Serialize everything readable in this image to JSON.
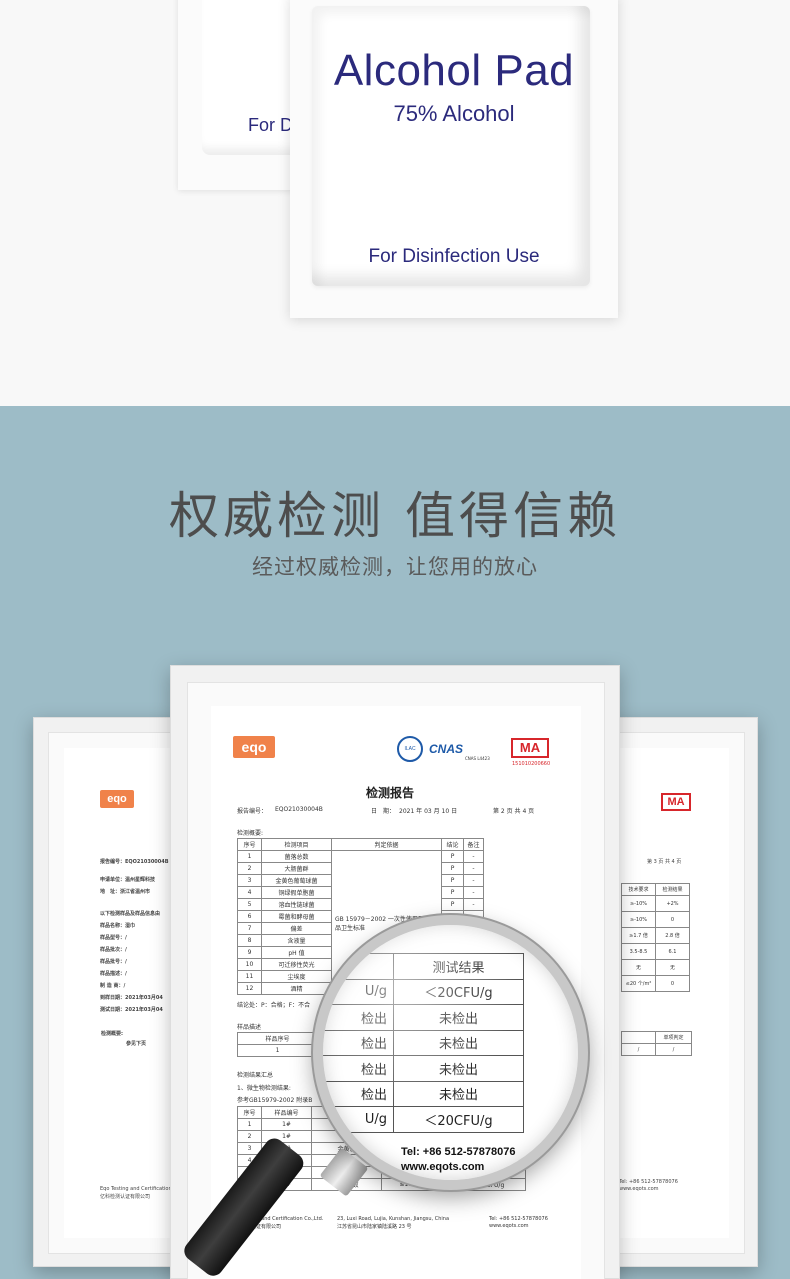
{
  "product": {
    "back_pad_text": "For Di",
    "title": "Alcohol Pad",
    "subtitle": "75% Alcohol",
    "usage": "For Disinfection Use",
    "brand_color": "#2b2a7c"
  },
  "section": {
    "headline": "权威检测 值得信赖",
    "subheadline": "经过权威检测，让您用的放心",
    "background_color": "#9dbcc7"
  },
  "report": {
    "logo": "eqo",
    "cma": "MA",
    "cma_number": "151010200660",
    "cnas": "CNAS",
    "cnas_code": "CNAS L4423",
    "title": "检测报告",
    "report_no_label": "报告编号：",
    "report_no": "EQO2103000​4B",
    "date_label": "日　期：",
    "date": "2021 年 03 月 10 日",
    "page": "第 2 页 共 4 页",
    "summary_label": "检测概要:",
    "columns": [
      "序号",
      "检测项目",
      "判定依据",
      "结论",
      "备注"
    ],
    "rows": [
      [
        "1",
        "菌落总数",
        "P",
        "-"
      ],
      [
        "2",
        "大肠菌群",
        "P",
        "-"
      ],
      [
        "3",
        "金黄色葡萄球菌",
        "P",
        "-"
      ],
      [
        "4",
        "铜绿假单胞菌",
        "P",
        "-"
      ],
      [
        "5",
        "溶血性链球菌",
        "P",
        "-"
      ],
      [
        "6",
        "霉菌和酵母菌",
        "P",
        "-"
      ],
      [
        "7",
        "偏差",
        "P",
        "-"
      ],
      [
        "8",
        "含液量",
        "P",
        "-"
      ],
      [
        "9",
        "pH 值",
        "P",
        "-"
      ],
      [
        "10",
        "可迁移性荧光",
        "P",
        "-"
      ],
      [
        "11",
        "尘埃度",
        "P",
        "-"
      ],
      [
        "12",
        "酒精",
        "P",
        "-"
      ]
    ],
    "standard": "GB 15979－2002 一次性使用卫生用品卫生标准",
    "conclusion": "结论处：P：合格；F：不合",
    "sample_label": "样品描述",
    "sample_col": "样品序号",
    "sample_no": "1",
    "results_label": "检测结果汇总",
    "micro_label": "1、微生物检测结果:",
    "ref_label": "参考GB15979-2002 附录B",
    "bottom_columns": [
      "序号",
      "样品编号"
    ],
    "bottom_rows": [
      [
        "1",
        "1#",
        "",
        "",
        ""
      ],
      [
        "2",
        "1#",
        "大",
        "",
        ""
      ],
      [
        "3",
        "1#",
        "金黄色",
        "",
        ""
      ],
      [
        "4",
        "1#",
        "溶",
        "不得检出",
        "未检出"
      ],
      [
        "5",
        "1#",
        "",
        "不得检出",
        "未检出"
      ],
      [
        "6",
        "1#",
        "真菌总数",
        "≤100CFU/g",
        "＜20CFU/g"
      ]
    ],
    "footer_company": "Eqo Testing and Certification Co.,Ltd.",
    "footer_company_cn": "亿科检测认证有限公司",
    "footer_address": "23, Luxi Road, Lujia, Kunshan, Jiangsu, China",
    "footer_address_cn": "江苏省昆山市陆家镇陆溪路 23 号",
    "footer_tel": "Tel: +86 512-57878076",
    "footer_web": "www.eqots.com"
  },
  "left_report": {
    "logo": "eqo",
    "lines": [
      "报告编号：EQO21030004B",
      "申请单位：温州星辉科技",
      "地　址：浙江省温州市",
      "以下检测样品及样品信息由",
      "样品名称：湿巾",
      "样品型号：/",
      "样品批次：/",
      "样品批号：/",
      "样品描述：/",
      "制 造 商：/",
      "到样日期：2021年03月04",
      "测试日期：2021年03月04"
    ],
    "summary": "检测概要:",
    "summary_note": "参见下页",
    "footer": "Eqo Testing and Certification Co.,Ltd.",
    "footer_cn": "亿科检测认证有限公司"
  },
  "right_report": {
    "cma": "MA",
    "page": "第 3 页 共 4 页",
    "cols": [
      "技术要求",
      "检测结果"
    ],
    "rows": [
      [
        "≥-10%",
        "+2%"
      ],
      [
        "≥-10%",
        "0"
      ],
      [
        "≥1.7 倍",
        "2.8 倍"
      ],
      [
        "3.5-8.5",
        "6.1"
      ],
      [
        "无",
        "无"
      ],
      [
        "≤20 个/m²",
        "0"
      ]
    ],
    "judge_col": "单项判定",
    "footer_tel": "Tel: +86 512-57878076",
    "footer_web": "www.eqots.com"
  },
  "magnifier": {
    "header": "测试结果",
    "rows": [
      {
        "left": "U/g",
        "right": "＜20CFU/g"
      },
      {
        "left": "检出",
        "right": "未检出"
      },
      {
        "left": "检出",
        "right": "未检出"
      },
      {
        "left": "检出",
        "right": "未检出"
      },
      {
        "left": "检出",
        "right": "未检出"
      },
      {
        "left": "U/g",
        "right": "＜20CFU/g"
      }
    ],
    "tel": "Tel: +86 512-57878076",
    "web": "www.eqots.com"
  }
}
